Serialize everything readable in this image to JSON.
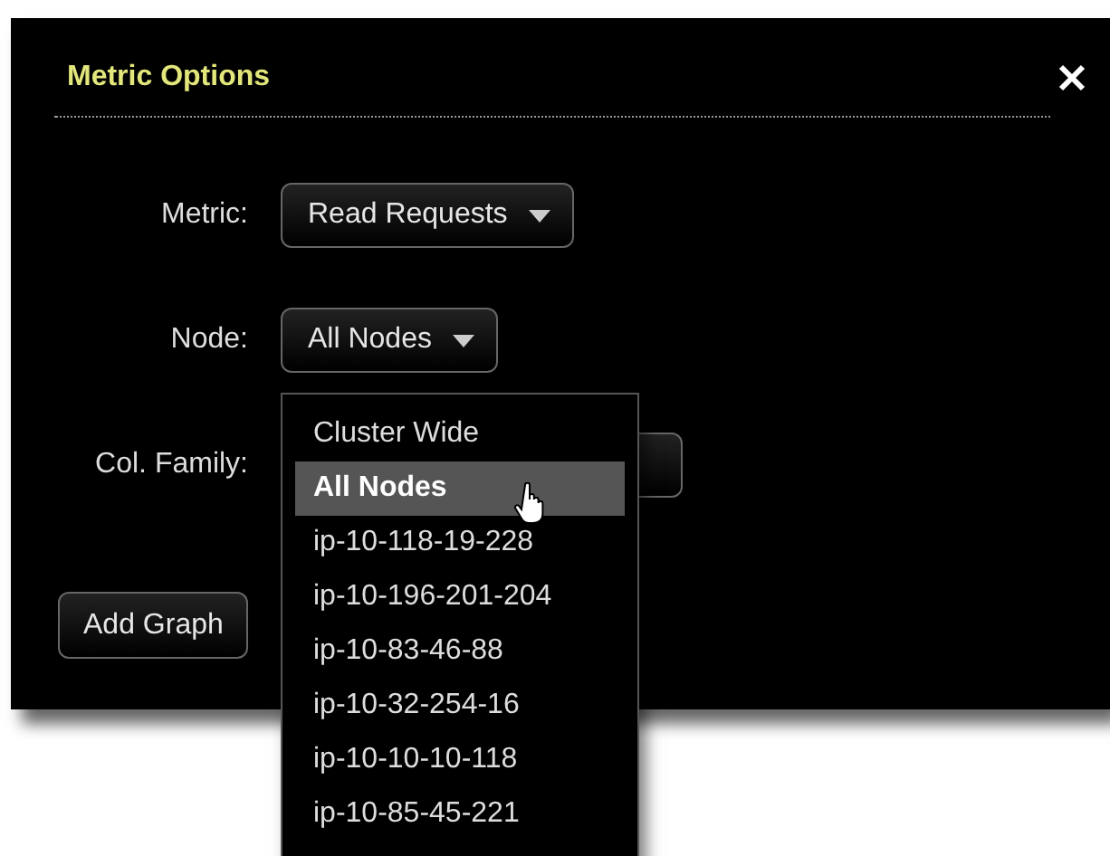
{
  "dialog": {
    "title": "Metric Options",
    "fields": [
      {
        "label": "Metric:",
        "value": "Read Requests"
      },
      {
        "label": "Node:",
        "value": "All Nodes"
      },
      {
        "label": "Col. Family:"
      }
    ],
    "node_dropdown": {
      "options": [
        {
          "label": "Cluster Wide",
          "selected": false
        },
        {
          "label": "All Nodes",
          "selected": true
        },
        {
          "label": "ip-10-118-19-228",
          "selected": false
        },
        {
          "label": "ip-10-196-201-204",
          "selected": false
        },
        {
          "label": "ip-10-83-46-88",
          "selected": false
        },
        {
          "label": "ip-10-32-254-16",
          "selected": false
        },
        {
          "label": "ip-10-10-10-118",
          "selected": false
        },
        {
          "label": "ip-10-85-45-221",
          "selected": false
        }
      ]
    },
    "buttons": [
      "Add Graph"
    ]
  }
}
